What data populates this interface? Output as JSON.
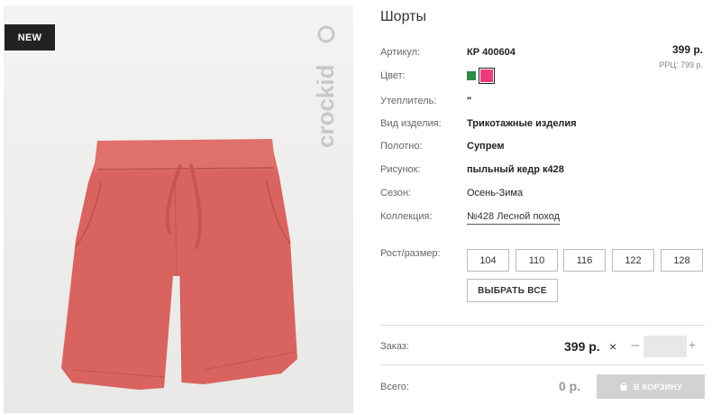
{
  "product": {
    "badge": "NEW",
    "brand": "crockid",
    "title": "Шорты",
    "price": "399 р.",
    "rrp": "РРЦ: 799 р."
  },
  "specs": [
    {
      "label": "Артикул:",
      "value": "КР 400604"
    },
    {
      "label": "Цвет:",
      "value": ""
    },
    {
      "label": "Утеплитель:",
      "value": "\""
    },
    {
      "label": "Вид изделия:",
      "value": "Трикотажные изделия"
    },
    {
      "label": "Полотно:",
      "value": "Супрем"
    },
    {
      "label": "Рисунок:",
      "value": "пыльный кедр к428"
    },
    {
      "label": "Сезон:",
      "value": "Осень-Зима"
    },
    {
      "label": "Коллекция:",
      "value": "№428 Лесной поход"
    }
  ],
  "colors": [
    "#2e8b4a",
    "#ec3b7c"
  ],
  "sizes": {
    "label": "Рост/размер:",
    "options": [
      "104",
      "110",
      "116",
      "122",
      "128"
    ],
    "select_all": "ВЫБРАТЬ ВСЕ"
  },
  "order": {
    "label": "Заказ:",
    "price": "399 р.",
    "times": "×",
    "minus": "–",
    "plus": "+",
    "quantity": ""
  },
  "total": {
    "label": "Всего:",
    "value": "0 р.",
    "cart_label": "В КОРЗИНУ"
  }
}
